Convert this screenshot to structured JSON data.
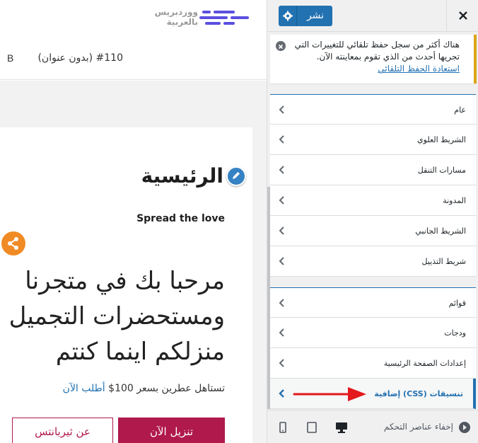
{
  "preview": {
    "logo_text": "ووردبريس بالعربية",
    "menu_b": "B",
    "menu_title": "#110 (بدون عنوان)",
    "page_title": "الرئيسية",
    "spread_love": "Spread the love",
    "hero_lines": [
      "مرحبا بك في متجرنا",
      "ومستحضرات التجميل",
      "منزلكم اينما كنتم"
    ],
    "promo_text": "تستاهل عطرين بسعر 100$",
    "promo_link": "أطلب الآن",
    "btn_primary": "تنزيل الآن",
    "btn_outline": "عن ثيربانتس"
  },
  "sidebar": {
    "publish_label": "نشر",
    "notice": {
      "text": "هناك أكثر من سجل حفظ تلقائي للتغييرات التي تجريها أحدث من الذي تقوم بمعاينته الآن.",
      "link": "استعادة الحفظ التلقائي"
    },
    "sections": [
      {
        "label": "عام"
      },
      {
        "label": "الشريط العلوي"
      },
      {
        "label": "مسارات التنقل"
      },
      {
        "label": "المدونة"
      },
      {
        "label": "الشريط الجانبي"
      },
      {
        "label": "شريط التذييل"
      }
    ],
    "sections2": [
      {
        "label": "قوائم"
      },
      {
        "label": "ودجات"
      },
      {
        "label": "إعدادات الصفحة الرئيسية"
      },
      {
        "label": "تنسيقات (CSS) إضافية"
      }
    ],
    "footer": {
      "collapse_label": "إخفاء عناصر التحكم"
    }
  },
  "colors": {
    "accent": "#2271b1",
    "brand_button": "#b0194b",
    "share": "#f08a24",
    "annotation_arrow": "#e3191d"
  }
}
